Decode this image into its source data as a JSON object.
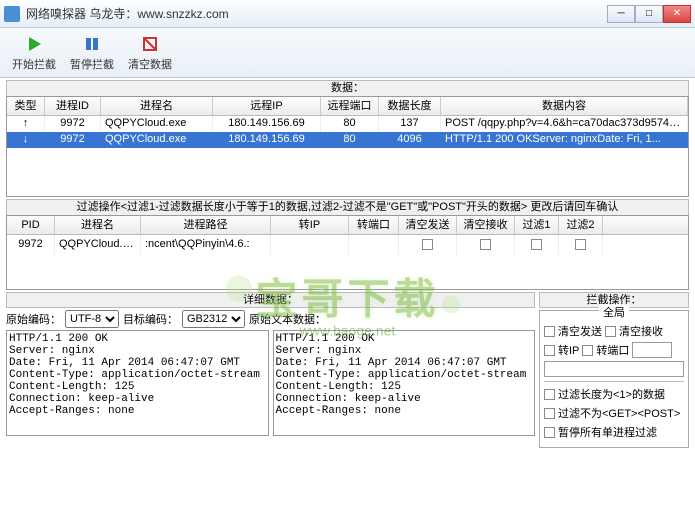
{
  "window": {
    "title": "网络嗅探器  乌龙寺：www.snzzkz.com"
  },
  "toolbar": {
    "start": "开始拦截",
    "pause": "暂停拦截",
    "clear": "清空数据"
  },
  "dataPanel": {
    "title": "数据：",
    "headers": {
      "type": "类型",
      "pid": "进程ID",
      "pname": "进程名",
      "rip": "远程IP",
      "rport": "远程端口",
      "dlen": "数据长度",
      "content": "数据内容"
    },
    "rows": [
      {
        "type": "↑",
        "pid": "9972",
        "pname": "QQPYCloud.exe",
        "rip": "180.149.156.69",
        "rport": "80",
        "dlen": "137",
        "content": "POST /qqpy.php?v=4.6&h=ca70dac373d9574e5..."
      },
      {
        "type": "↓",
        "pid": "9972",
        "pname": "QQPYCloud.exe",
        "rip": "180.149.156.69",
        "rport": "80",
        "dlen": "4096",
        "content": "HTTP/1.1 200 OKServer: nginxDate: Fri, 1..."
      }
    ]
  },
  "filterPanel": {
    "title": "过滤操作<过滤1-过滤数据长度小于等于1的数据,过滤2-过滤不是\"GET\"或\"POST\"开头的数据> 更改后请回车确认",
    "headers": {
      "pid": "PID",
      "pname": "进程名",
      "path": "进程路径",
      "tip": "转IP",
      "tport": "转端口",
      "cs": "清空发送",
      "cr": "清空接收",
      "f1": "过滤1",
      "f2": "过滤2"
    },
    "rows": [
      {
        "pid": "9972",
        "pname": "QQPYCloud.exe",
        "path": ":ncent\\QQPinyin\\4.6.:"
      }
    ]
  },
  "detail": {
    "title": "详细数据：",
    "origLabel": "原始编码：",
    "origEnc": "UTF-8",
    "targLabel": "目标编码：",
    "targEnc": "GB2312",
    "rawTextLabel": "原始文本数据：",
    "text": "HTTP/1.1 200 OK\nServer: nginx\nDate: Fri, 11 Apr 2014 06:47:07 GMT\nContent-Type: application/octet-stream\nContent-Length: 125\nConnection: keep-alive\nAccept-Ranges: none\n"
  },
  "intercept": {
    "title": "拦截操作：",
    "global": "全局",
    "clearSend": "清空发送",
    "clearRecv": "清空接收",
    "transIP": "转IP",
    "transPort": "转端口",
    "filterLen": "过滤长度为<1>的数据",
    "filterMethod": "过滤不为<GET><POST>",
    "pauseAll": "暂停所有单进程过滤"
  },
  "watermark": {
    "main": "宝哥下载",
    "sub": "www.baoge.net"
  }
}
